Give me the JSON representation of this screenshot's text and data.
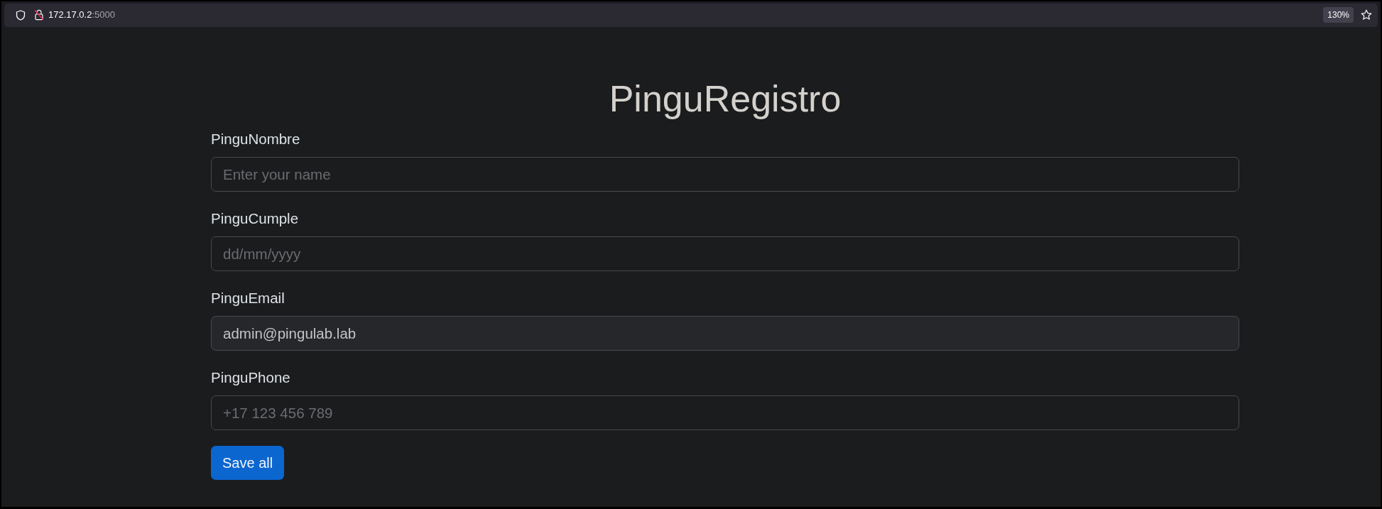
{
  "browser": {
    "url_host": "172.17.0.2",
    "url_port": ":5000",
    "zoom": "130%"
  },
  "page": {
    "title": "PinguRegistro",
    "fields": [
      {
        "label": "PinguNombre",
        "placeholder": "Enter your name",
        "disabled": false
      },
      {
        "label": "PinguCumple",
        "placeholder": "dd/mm/yyyy",
        "disabled": false
      },
      {
        "label": "PinguEmail",
        "value": "admin@pingulab.lab",
        "disabled": true
      },
      {
        "label": "PinguPhone",
        "placeholder": "+17 123 456 789",
        "disabled": false
      }
    ],
    "submit": "Save all"
  }
}
